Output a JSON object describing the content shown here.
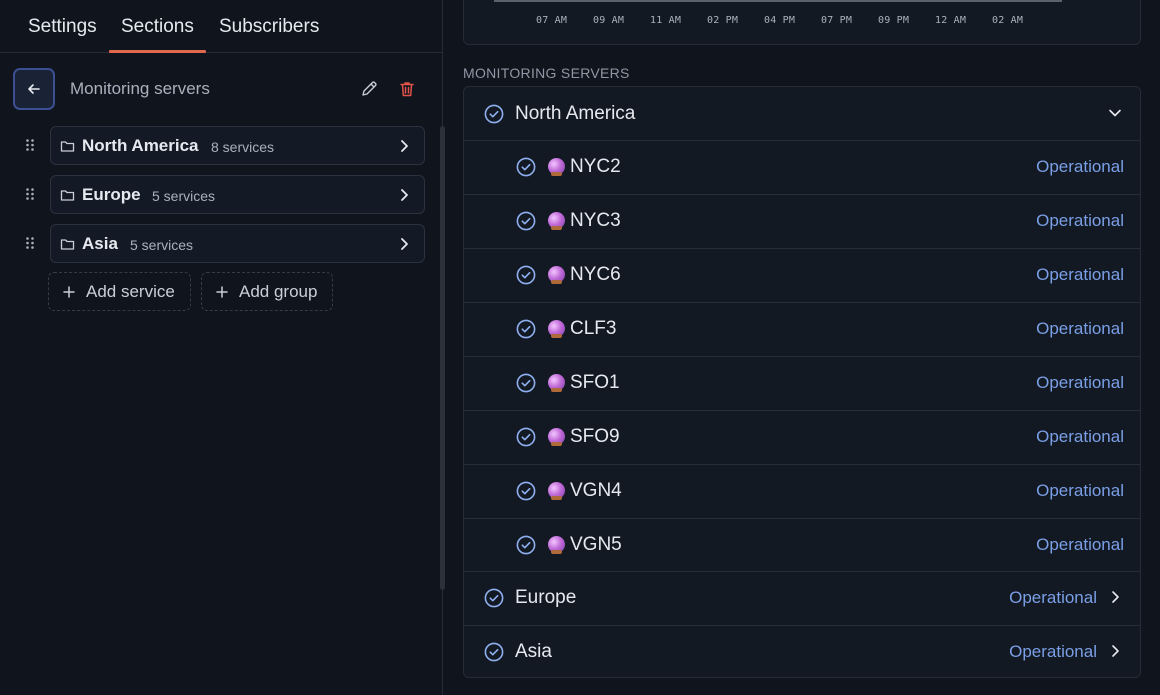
{
  "tabs": [
    {
      "label": "Settings"
    },
    {
      "label": "Sections"
    },
    {
      "label": "Subscribers"
    }
  ],
  "active_tab": "Sections",
  "panel": {
    "title": "Monitoring servers",
    "groups": [
      {
        "name": "North America",
        "count": "8 services"
      },
      {
        "name": "Europe",
        "count": "5 services"
      },
      {
        "name": "Asia",
        "count": "5 services"
      }
    ],
    "add_service_label": "Add service",
    "add_group_label": "Add group"
  },
  "chart": {
    "ticks": [
      "07 AM",
      "09 AM",
      "11 AM",
      "02 PM",
      "04 PM",
      "07 PM",
      "09 PM",
      "12 AM",
      "02 AM"
    ]
  },
  "preview": {
    "section_label": "MONITORING SERVERS",
    "groups": [
      {
        "name": "North America",
        "expanded": true,
        "services": [
          {
            "name": "NYC2",
            "status": "Operational"
          },
          {
            "name": "NYC3",
            "status": "Operational"
          },
          {
            "name": "NYC6",
            "status": "Operational"
          },
          {
            "name": "CLF3",
            "status": "Operational"
          },
          {
            "name": "SFO1",
            "status": "Operational"
          },
          {
            "name": "SFO9",
            "status": "Operational"
          },
          {
            "name": "VGN4",
            "status": "Operational"
          },
          {
            "name": "VGN5",
            "status": "Operational"
          }
        ]
      },
      {
        "name": "Europe",
        "status": "Operational",
        "expanded": false
      },
      {
        "name": "Asia",
        "status": "Operational",
        "expanded": false
      }
    ]
  },
  "colors": {
    "background": "#0f141d",
    "accent_tab": "#e2674f",
    "status_operational": "#7a9fe6",
    "delete_red": "#e2534a",
    "check_blue": "#8fb0f0"
  },
  "icons": [
    "arrow-left-icon",
    "pencil-icon",
    "trash-icon",
    "drag-handle-icon",
    "folder-icon",
    "chevron-right-icon",
    "chevron-down-icon",
    "plus-icon",
    "check-circle-icon",
    "crystal-ball-icon"
  ]
}
